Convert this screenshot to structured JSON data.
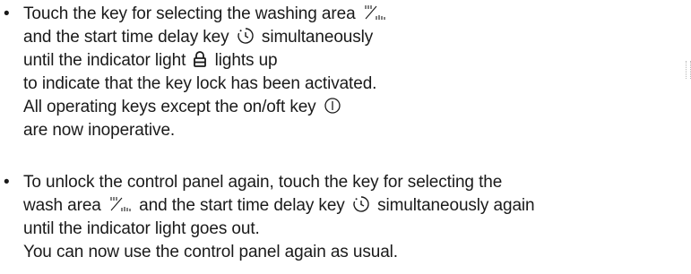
{
  "instructions": [
    {
      "bullet": "•",
      "segments": [
        "Touch the key for selecting the washing area",
        "and the start time delay key",
        "simultaneously",
        "until the indicator light",
        "lights up",
        "to indicate that the key lock has been activated.",
        "All operating keys except the on/oft key",
        "are now inoperative."
      ]
    },
    {
      "bullet": "•",
      "segments": [
        "To unlock the control panel again, touch the key for selecting the",
        "wash area",
        "and the start time delay key",
        "simultaneously again",
        "until the indicator light goes out.",
        "You can now use the control panel again as usual."
      ]
    }
  ],
  "icons": {
    "wash_area": "wash-area-icon",
    "start_time_delay": "timer-icon",
    "key_lock": "lock-icon",
    "power": "power-icon"
  },
  "colors": {
    "text": "#1a1a1a",
    "icon": "#1a1a1a"
  }
}
